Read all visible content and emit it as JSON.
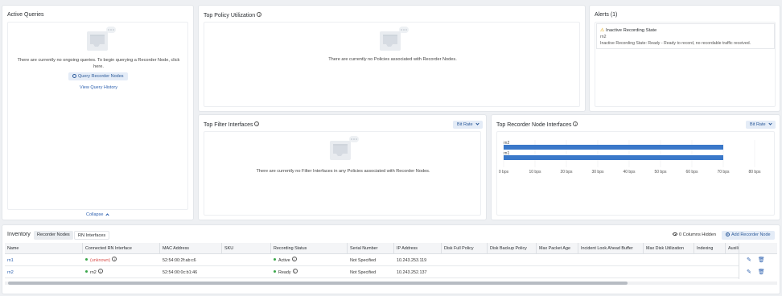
{
  "active_queries": {
    "title": "Active Queries",
    "empty_text": "There are currently no ongoing queries. To begin querying a Recorder Node, click here.",
    "query_button": "Query Recorder Nodes",
    "history_link": "View Query History",
    "collapse_link": "Collapse"
  },
  "top_policy": {
    "title": "Top Policy Utilization",
    "empty_text": "There are currently no Policies associated with Recorder Nodes."
  },
  "alerts": {
    "title": "Alerts (1)",
    "items": [
      {
        "title": "Inactive Recording State",
        "node": "rn2",
        "detail": "Inactive Recording State: Ready - Ready to record, no recordable traffic received."
      }
    ]
  },
  "top_filter": {
    "title": "Top Filter Interfaces",
    "dropdown": "Bit Rate",
    "empty_text": "There are currently no Filter Interfaces in any Policies associated with Recorder Nodes."
  },
  "top_rn_interfaces": {
    "title": "Top Recorder Node Interfaces",
    "dropdown": "Bit Rate"
  },
  "chart_data": {
    "type": "bar",
    "orientation": "horizontal",
    "categories": [
      "rn2",
      "rn1"
    ],
    "values": [
      70,
      70
    ],
    "xlim": [
      0,
      80
    ],
    "xticks": [
      "0 bps",
      "10 bps",
      "20 bps",
      "30 bps",
      "40 bps",
      "50 bps",
      "60 bps",
      "70 bps",
      "80 bps"
    ],
    "bar_color": "#3a78c9",
    "grid": true
  },
  "inventory": {
    "title": "Inventory",
    "tabs": [
      "Recorder Nodes",
      "RN Interfaces"
    ],
    "columns_hidden": "0 Columns Hidden",
    "add_button": "Add Recorder Node",
    "columns": [
      "Name",
      "Connected RN Interface",
      "MAC Address",
      "SKU",
      "Recording Status",
      "Serial Number",
      "IP Address",
      "Disk Full Policy",
      "Disk Backup Policy",
      "Max Packet Age",
      "Incident Look Ahead Buffer",
      "Max Disk Utilization",
      "Indexing",
      "Auxili"
    ],
    "rows": [
      {
        "name": "rn1",
        "interface": "(unknown)",
        "interface_color": "#d9534f",
        "interface_dot": "#3aa64a",
        "mac": "52:54:00:2f:ab:c6",
        "sku": "",
        "status": "Active",
        "status_dot": "#3aa64a",
        "serial": "Not Specified",
        "ip": "10.243.253.119"
      },
      {
        "name": "rn2",
        "interface": "rn2",
        "interface_color": "#333333",
        "interface_dot": "#3aa64a",
        "mac": "52:54:00:0c:b1:46",
        "sku": "",
        "status": "Ready",
        "status_dot": "#3aa64a",
        "serial": "Not Specified",
        "ip": "10.243.252.137"
      }
    ]
  }
}
